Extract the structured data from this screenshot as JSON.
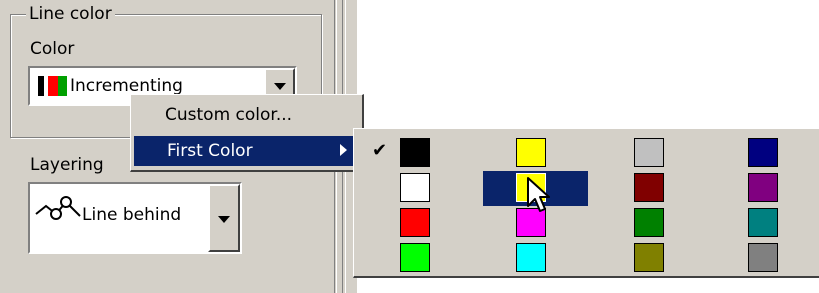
{
  "panel": {
    "group_title": "Line color",
    "color_label": "Color",
    "color_value": "Incrementing",
    "layering_label": "Layering",
    "layering_value": "Line behind"
  },
  "context_menu": {
    "items": [
      {
        "label": "Custom color..."
      },
      {
        "label": "First Color",
        "has_submenu": true,
        "highlighted": true
      }
    ]
  },
  "palette": {
    "checked": "black",
    "highlighted": "yellow-row2",
    "colors": [
      "#000000",
      "#ffff00",
      "#c0c0c0",
      "#000080",
      "#ffffff",
      "#ffff00",
      "#800000",
      "#800080",
      "#ff0000",
      "#ff00ff",
      "#008000",
      "#008080",
      "#00ff00",
      "#00ffff",
      "#808000",
      "#808080"
    ]
  },
  "icons": [
    "checkmark-icon",
    "submenu-arrow-icon",
    "dropdown-arrow-icon",
    "line-behind-icon",
    "mouse-cursor-icon"
  ]
}
